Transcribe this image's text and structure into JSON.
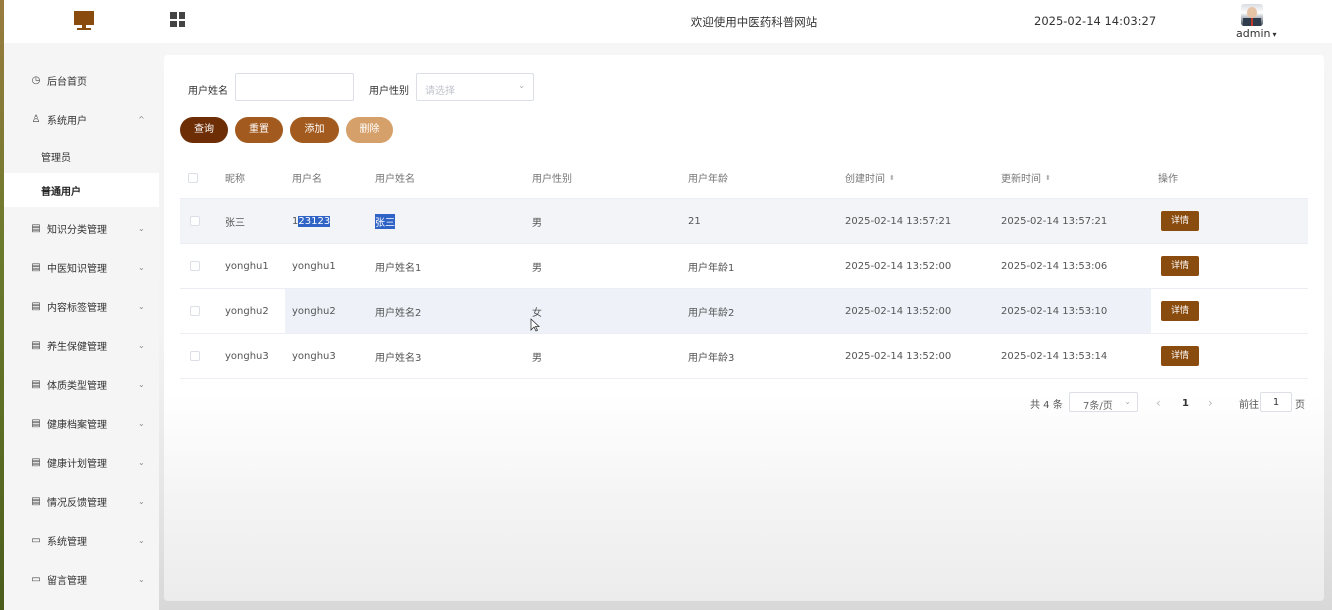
{
  "header": {
    "title": "欢迎使用中医药科普网站",
    "datetime": "2025-02-14 14:03:27",
    "user": "admin",
    "caret": "▾"
  },
  "sidebar": {
    "items": [
      {
        "label": "后台首页",
        "icon": "clock-icon",
        "glyph": "◷",
        "arrow": ""
      },
      {
        "label": "系统用户",
        "icon": "user-icon",
        "glyph": "♙",
        "arrow": "^"
      },
      {
        "label": "知识分类管理",
        "icon": "list-icon",
        "glyph": "▤",
        "arrow": "⌄"
      },
      {
        "label": "中医知识管理",
        "icon": "list-icon",
        "glyph": "▤",
        "arrow": "⌄"
      },
      {
        "label": "内容标签管理",
        "icon": "list-icon",
        "glyph": "▤",
        "arrow": "⌄"
      },
      {
        "label": "养生保健管理",
        "icon": "list-icon",
        "glyph": "▤",
        "arrow": "⌄"
      },
      {
        "label": "体质类型管理",
        "icon": "list-icon",
        "glyph": "▤",
        "arrow": "⌄"
      },
      {
        "label": "健康档案管理",
        "icon": "list-icon",
        "glyph": "▤",
        "arrow": "⌄"
      },
      {
        "label": "健康计划管理",
        "icon": "list-icon",
        "glyph": "▤",
        "arrow": "⌄"
      },
      {
        "label": "情况反馈管理",
        "icon": "list-icon",
        "glyph": "▤",
        "arrow": "⌄"
      },
      {
        "label": "系统管理",
        "icon": "folder-icon",
        "glyph": "▭",
        "arrow": "⌄"
      },
      {
        "label": "留言管理",
        "icon": "folder-icon",
        "glyph": "▭",
        "arrow": "⌄"
      }
    ],
    "sub_items": [
      "管理员",
      "普通用户"
    ]
  },
  "search": {
    "name_label": "用户姓名",
    "name_value": "",
    "gender_label": "用户性别",
    "gender_placeholder": "请选择",
    "arrow": "⌄"
  },
  "buttons": {
    "query": "查询",
    "reset": "重置",
    "add": "添加",
    "delete": "删除"
  },
  "table": {
    "columns": [
      "昵称",
      "用户名",
      "用户姓名",
      "用户性别",
      "用户年龄",
      "创建时间",
      "更新时间",
      "操作"
    ],
    "sort_glyph": "⬍",
    "detail_label": "详情",
    "rows": [
      {
        "nickname": "张三",
        "username_a": "1",
        "username_b": "23123",
        "realname": "张三",
        "gender": "男",
        "age": "21",
        "created": "2025-02-14 13:57:21",
        "updated": "2025-02-14 13:57:21"
      },
      {
        "nickname": "yonghu1",
        "username": "yonghu1",
        "realname": "用户姓名1",
        "gender": "男",
        "age": "用户年龄1",
        "created": "2025-02-14 13:52:00",
        "updated": "2025-02-14 13:53:06"
      },
      {
        "nickname": "yonghu2",
        "username": "yonghu2",
        "realname": "用户姓名2",
        "gender": "女",
        "age": "用户年龄2",
        "created": "2025-02-14 13:52:00",
        "updated": "2025-02-14 13:53:10"
      },
      {
        "nickname": "yonghu3",
        "username": "yonghu3",
        "realname": "用户姓名3",
        "gender": "男",
        "age": "用户年龄3",
        "created": "2025-02-14 13:52:00",
        "updated": "2025-02-14 13:53:14"
      }
    ]
  },
  "pagination": {
    "total": "共 4 条",
    "page_size": "7条/页",
    "page_size_arrow": "⌄",
    "prev": "‹",
    "current": "1",
    "next": "›",
    "goto_label": "前往",
    "goto_value": "1",
    "page_suffix": "页"
  }
}
